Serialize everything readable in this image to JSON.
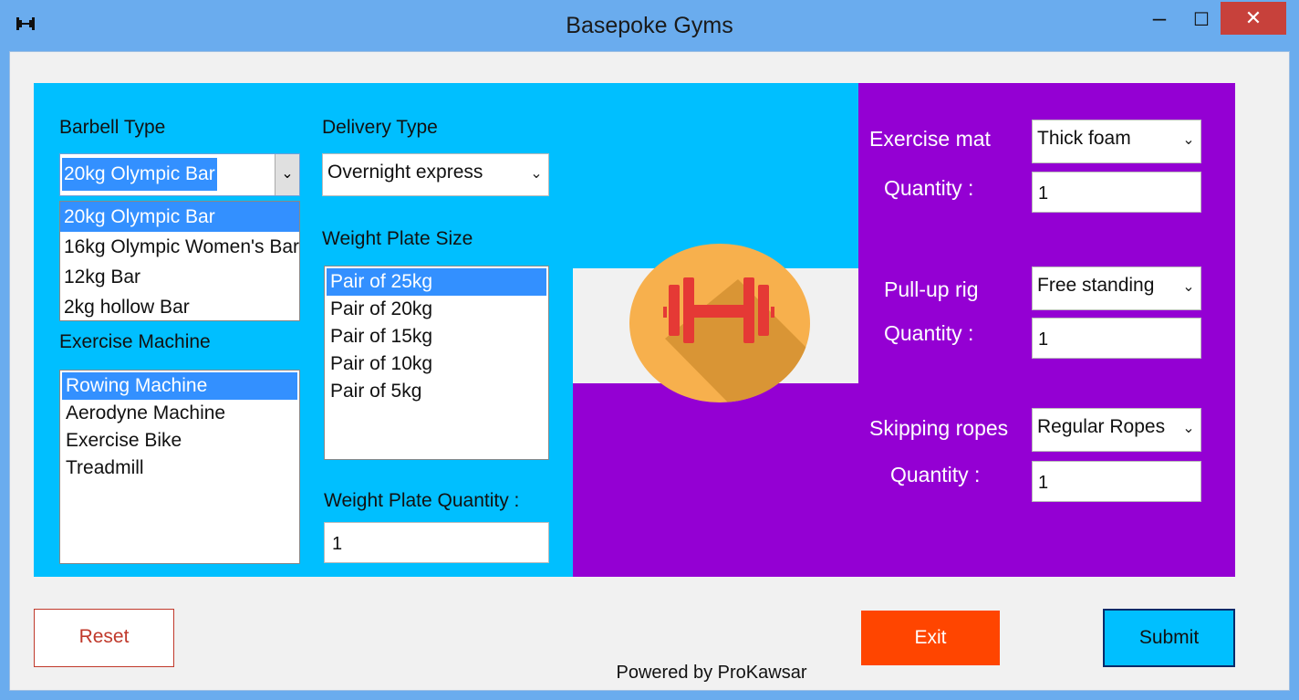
{
  "window": {
    "title": "Basepoke Gyms",
    "minimize": "–",
    "maximize": "☐",
    "close": "✕",
    "app_icon": "dumbbell-icon"
  },
  "barbell": {
    "label": "Barbell Type",
    "value": "20kg Olympic Bar",
    "options": [
      "20kg Olympic Bar",
      "16kg Olympic Women's Bar",
      "12kg Bar",
      "2kg hollow Bar"
    ],
    "selected": 0
  },
  "delivery": {
    "label": "Delivery Type",
    "value": "Overnight express"
  },
  "machine": {
    "label": "Exercise Machine",
    "options": [
      "Rowing Machine",
      "Aerodyne Machine",
      "Exercise Bike",
      "Treadmill"
    ],
    "selected": 0
  },
  "plate_size": {
    "label": "Weight Plate Size",
    "options": [
      "Pair of 25kg",
      "Pair of 20kg",
      "Pair of 15kg",
      "Pair of 10kg",
      "Pair of 5kg"
    ],
    "selected": 0
  },
  "plate_qty": {
    "label": "Weight Plate Quantity :",
    "value": "1"
  },
  "mat": {
    "label": "Exercise mat",
    "value": "Thick foam",
    "qty_label": "Quantity :",
    "qty": "1"
  },
  "rig": {
    "label": "Pull-up rig",
    "value": "Free standing",
    "qty_label": "Quantity :",
    "qty": "1"
  },
  "ropes": {
    "label": "Skipping ropes",
    "value": "Regular Ropes",
    "qty_label": "Quantity :",
    "qty": "1"
  },
  "buttons": {
    "reset": "Reset",
    "exit": "Exit",
    "submit": "Submit"
  },
  "footer": "Powered by ProKawsar",
  "colors": {
    "blue_panel": "#00bfff",
    "purple_panel": "#9400d3",
    "exit": "#ff4500",
    "selection": "#3390ff",
    "logo_circle": "#f7b04d",
    "logo_dumbbell": "#e53935"
  },
  "logo": "dumbbell-logo"
}
